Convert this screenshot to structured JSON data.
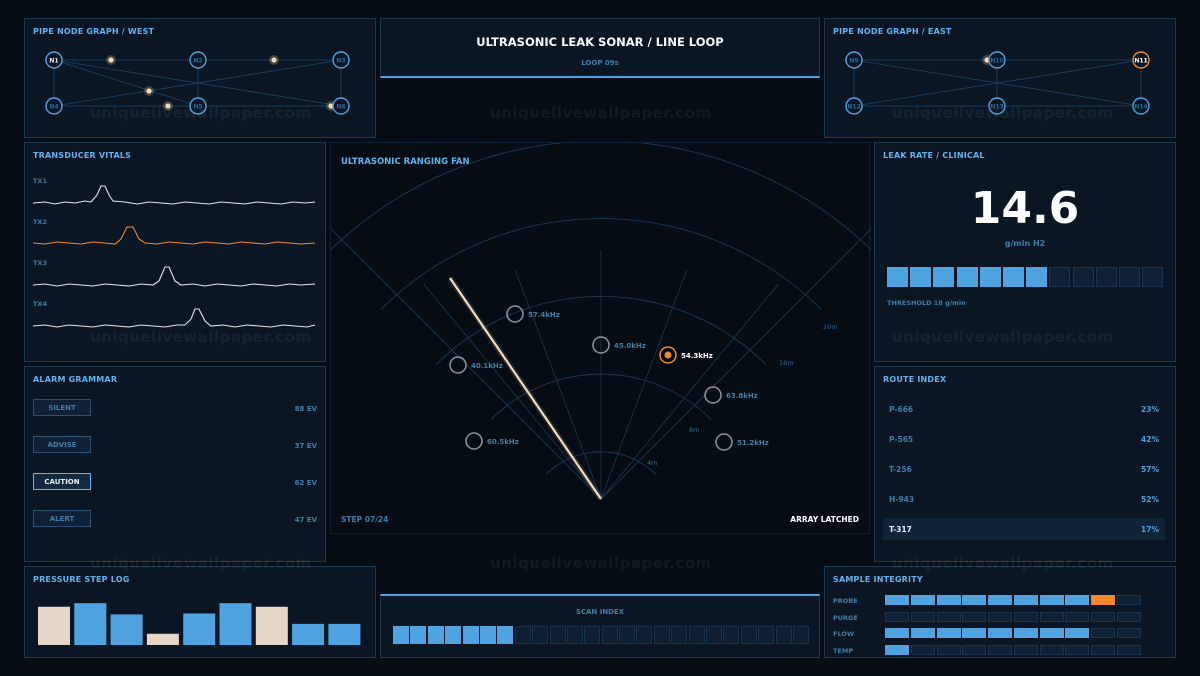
{
  "west_graph": {
    "title": "PIPE NODE GRAPH / WEST",
    "nodes": [
      "N1",
      "N2",
      "N3",
      "N4",
      "N5",
      "N6"
    ]
  },
  "header": {
    "title": "ULTRASONIC LEAK SONAR / LINE LOOP",
    "subtitle": "LOOP 09s"
  },
  "east_graph": {
    "title": "PIPE NODE GRAPH / EAST",
    "nodes": [
      "N9",
      "N10",
      "N11",
      "N12",
      "N13",
      "N14"
    ]
  },
  "vitals": {
    "title": "TRANSDUCER VITALS",
    "channels": [
      "TX1",
      "TX2",
      "TX3",
      "TX4"
    ]
  },
  "sonar": {
    "title": "ULTRASONIC RANGING FAN",
    "step": "STEP 07/24",
    "status": "ARRAY LATCHED",
    "range_labels": [
      "4m",
      "8m",
      "16m",
      "20m"
    ],
    "targets": [
      "57.4kHz",
      "45.0kHz",
      "54.3kHz",
      "40.1kHz",
      "63.8kHz",
      "60.5kHz",
      "51.2kHz"
    ]
  },
  "leak": {
    "title": "LEAK RATE / CLINICAL",
    "value": "14.6",
    "unit": "g/min H2",
    "threshold": "THRESHOLD 18 g/min",
    "level_fraction": 0.58
  },
  "alarm": {
    "title": "ALARM GRAMMAR",
    "states": [
      {
        "label": "SILENT",
        "count": "88 EV"
      },
      {
        "label": "ADVISE",
        "count": "37 EV"
      },
      {
        "label": "CAUTION",
        "count": "62 EV"
      },
      {
        "label": "ALERT",
        "count": "47 EV"
      }
    ]
  },
  "route": {
    "title": "ROUTE INDEX",
    "items": [
      {
        "name": "P-666",
        "pct": "23%"
      },
      {
        "name": "P-565",
        "pct": "42%"
      },
      {
        "name": "T-256",
        "pct": "57%"
      },
      {
        "name": "H-943",
        "pct": "52%"
      },
      {
        "name": "T-317",
        "pct": "17%"
      }
    ]
  },
  "pressure": {
    "title": "PRESSURE STEP LOG",
    "values": [
      0.85,
      0.93,
      0.68,
      0.25,
      0.7,
      0.93,
      0.85,
      0.47,
      0.47
    ]
  },
  "scan": {
    "title": "SCAN INDEX",
    "filled": 7,
    "total": 24
  },
  "integrity": {
    "title": "SAMPLE INTEGRITY",
    "rows": [
      {
        "label": "PROBE",
        "filled": 9,
        "alert": true
      },
      {
        "label": "PURGE",
        "filled": 0,
        "alert": false
      },
      {
        "label": "FLOW",
        "filled": 8,
        "alert": false
      },
      {
        "label": "TEMP",
        "filled": 1,
        "alert": false
      }
    ],
    "total": 10
  },
  "watermark": "uniquelivewallpaper.com",
  "colors": {
    "accent": "#4fa3e0",
    "alert": "#f08a2c",
    "bar_light": "#e6d6c8"
  }
}
